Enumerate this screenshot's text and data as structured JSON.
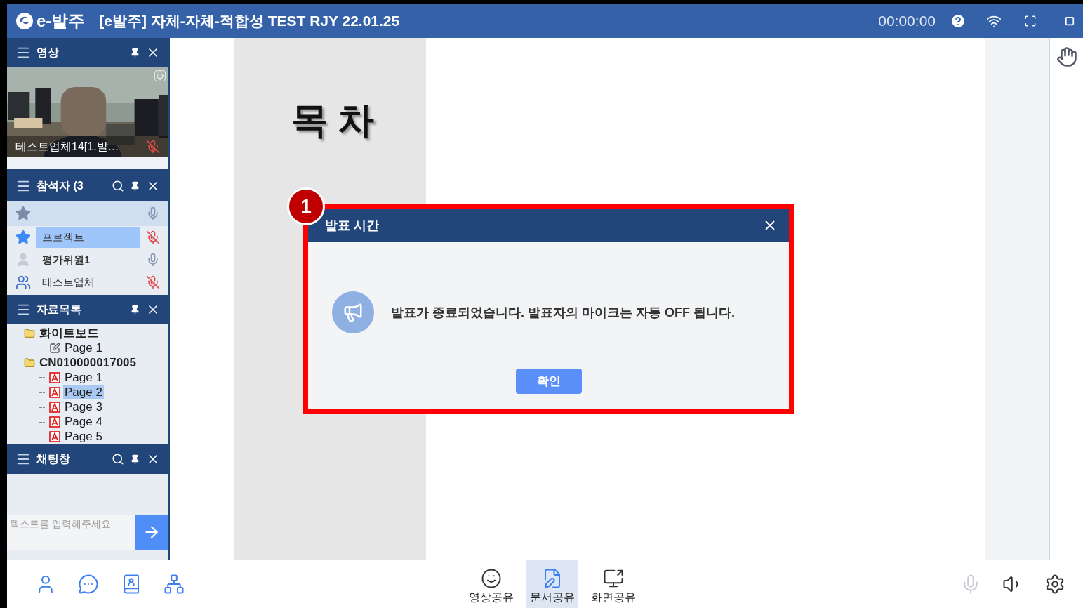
{
  "window": {
    "logo": "e-발주",
    "title": "[e발주] 자체-자체-적합성 TEST RJY 22.01.25",
    "timer": "00:00:00"
  },
  "video_panel": {
    "title": "영상",
    "caption": "테스트업체14[1.발…",
    "muted": true
  },
  "participants_panel": {
    "title": "참석자 (3",
    "favorites_row": {
      "muted": false
    },
    "rows": [
      {
        "name": "프로젝트",
        "kind": "star",
        "muted": true,
        "selected": true
      },
      {
        "name": "평가위원1",
        "kind": "person",
        "muted": false,
        "selected": false
      },
      {
        "name": "테스트업체",
        "kind": "group",
        "muted": true,
        "selected": false
      }
    ]
  },
  "files_panel": {
    "title": "자료목록",
    "tree": [
      {
        "label": "화이트보드",
        "kind": "folder",
        "selected": false,
        "children": [
          {
            "label": "Page 1",
            "kind": "whiteboard",
            "selected": false
          }
        ]
      },
      {
        "label": "CN010000017005",
        "kind": "folder",
        "selected": false,
        "children": [
          {
            "label": "Page 1",
            "kind": "pdf",
            "selected": false
          },
          {
            "label": "Page 2",
            "kind": "pdf",
            "selected": true
          },
          {
            "label": "Page 3",
            "kind": "pdf",
            "selected": false
          },
          {
            "label": "Page 4",
            "kind": "pdf",
            "selected": false
          },
          {
            "label": "Page 5",
            "kind": "pdf",
            "selected": false
          }
        ]
      }
    ]
  },
  "chat_panel": {
    "title": "채팅창",
    "placeholder": "텍스트를 입력해주세요"
  },
  "slide": {
    "heading": "목 차"
  },
  "dialog": {
    "badge": "1",
    "title": "발표 시간",
    "message": "발표가 종료되었습니다. 발표자의 마이크는 자동 OFF 됩니다.",
    "button": "확인"
  },
  "toolbar": {
    "left": [
      {
        "kind": "user"
      },
      {
        "kind": "chat"
      },
      {
        "kind": "contacts"
      },
      {
        "kind": "tree"
      }
    ],
    "center": [
      {
        "label": "영상공유",
        "kind": "video",
        "selected": false
      },
      {
        "label": "문서공유",
        "kind": "document",
        "selected": true
      },
      {
        "label": "화면공유",
        "kind": "screen",
        "selected": false
      }
    ],
    "right": [
      {
        "kind": "mic",
        "disabled": true
      },
      {
        "kind": "speaker",
        "disabled": false
      },
      {
        "kind": "settings",
        "disabled": false
      }
    ]
  }
}
